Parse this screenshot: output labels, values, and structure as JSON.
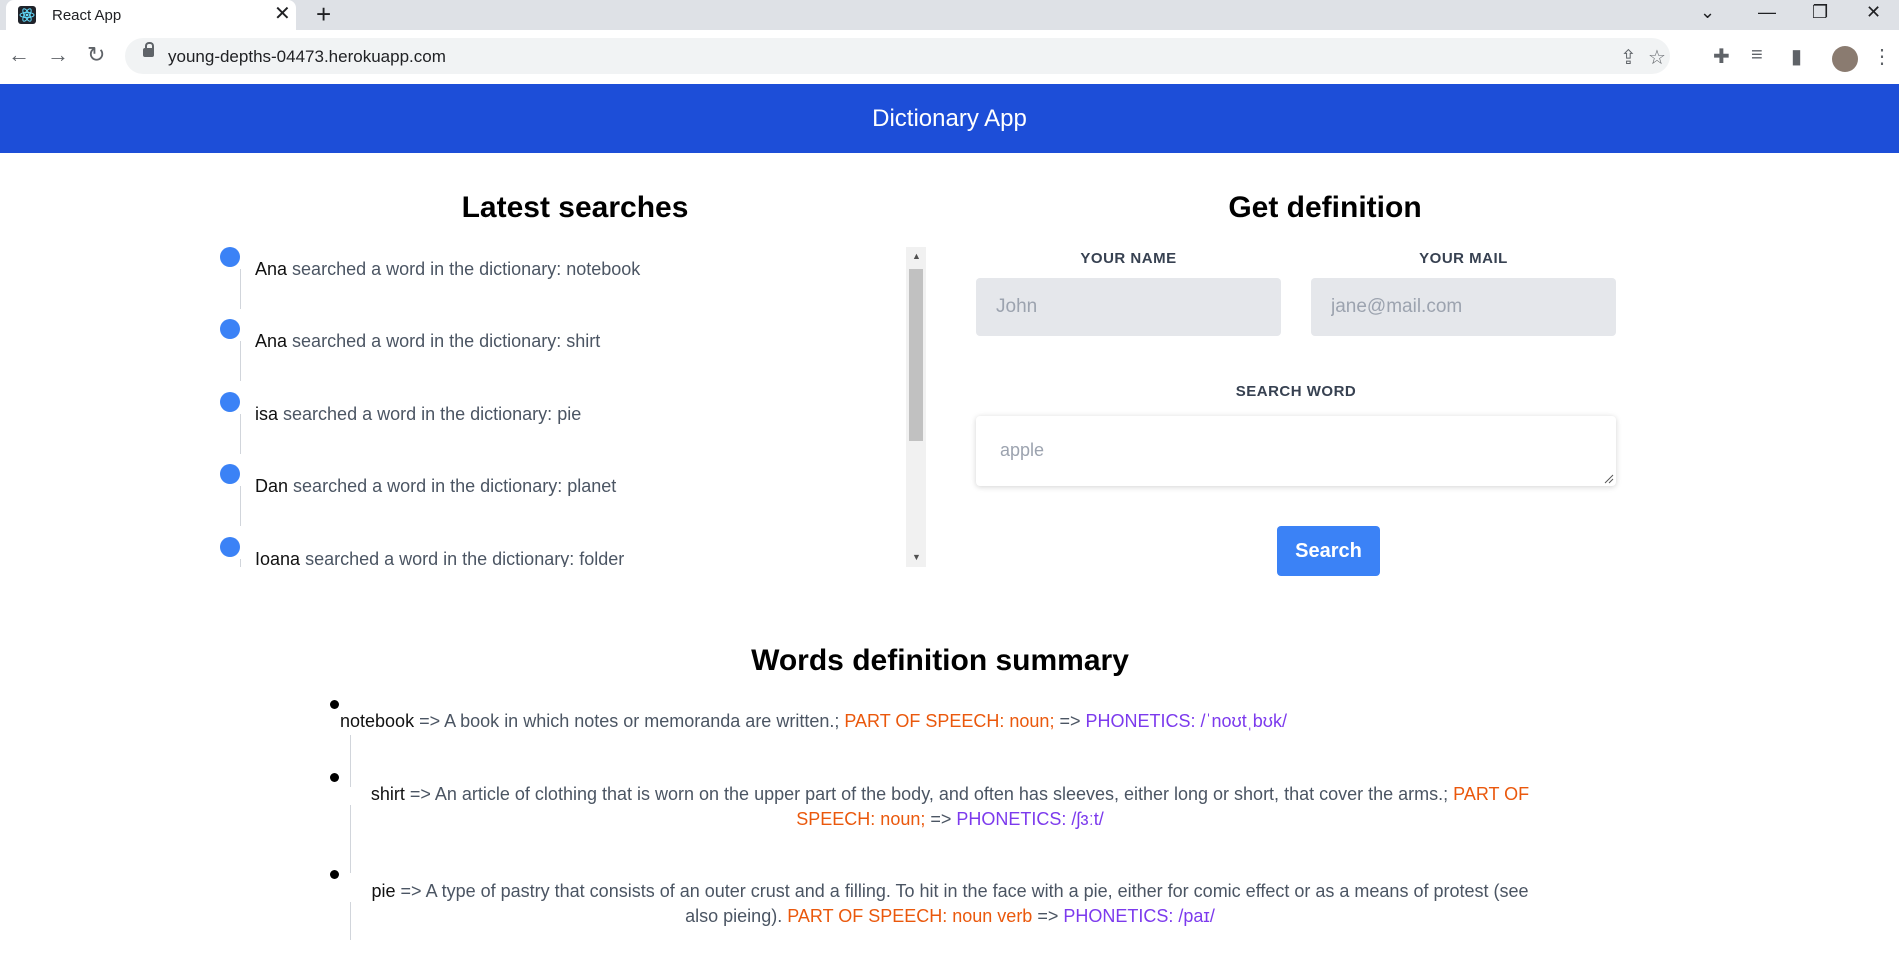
{
  "browser": {
    "tab_title": "React App",
    "url": "young-depths-04473.herokuapp.com"
  },
  "header": {
    "title": "Dictionary App"
  },
  "latest": {
    "title": "Latest searches",
    "connector": "searched a word in the dictionary:",
    "items": [
      {
        "name": "Ana",
        "word": "notebook"
      },
      {
        "name": "Ana",
        "word": "shirt"
      },
      {
        "name": "isa",
        "word": "pie"
      },
      {
        "name": "Dan",
        "word": "planet"
      },
      {
        "name": "Ioana",
        "word": "folder"
      }
    ]
  },
  "form": {
    "title": "Get definition",
    "name_label": "YOUR NAME",
    "name_placeholder": "John",
    "mail_label": "YOUR MAIL",
    "mail_placeholder": "jane@mail.com",
    "word_label": "SEARCH WORD",
    "word_placeholder": "apple",
    "search_label": "Search"
  },
  "summary": {
    "title": "Words definition summary",
    "arrow": "=>",
    "items": [
      {
        "word": "notebook",
        "definition": "A book in which notes or memoranda are written.;",
        "pos": "PART OF SPEECH: noun;",
        "phonetics": "PHONETICS: /ˈnoʊtˌbʊk/"
      },
      {
        "word": "shirt",
        "definition": "An article of clothing that is worn on the upper part of the body, and often has sleeves, either long or short, that cover the arms.;",
        "pos": "PART OF SPEECH: noun;",
        "phonetics": "PHONETICS: /ʃɜːt/"
      },
      {
        "word": "pie",
        "definition": "A type of pastry that consists of an outer crust and a filling. To hit in the face with a pie, either for comic effect or as a means of protest (see also pieing).",
        "pos": "PART OF SPEECH: noun verb",
        "phonetics": "PHONETICS: /paɪ/"
      }
    ]
  }
}
